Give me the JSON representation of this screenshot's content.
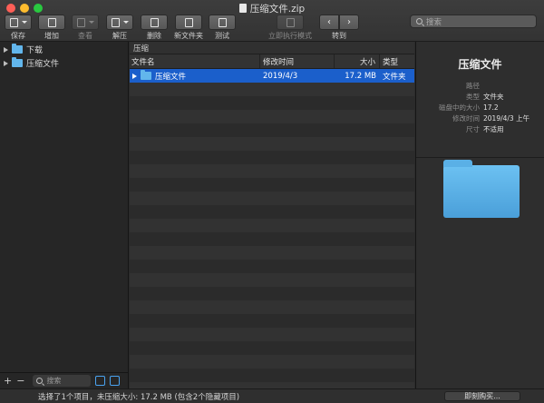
{
  "window": {
    "title": "压缩文件.zip"
  },
  "toolbar": {
    "save": "保存",
    "add": "增加",
    "view": "查看",
    "extract": "解压",
    "delete": "删除",
    "new_folder": "新文件夹",
    "test": "测试",
    "execute_now": "立即执行模式",
    "goto": "转到",
    "search_placeholder": "搜索"
  },
  "sidebar": {
    "items": [
      {
        "label": "下载"
      },
      {
        "label": "压缩文件"
      }
    ],
    "search_placeholder": "搜索"
  },
  "main": {
    "breadcrumb": "压缩",
    "columns": {
      "name": "文件名",
      "modified": "修改时间",
      "size": "大小",
      "kind": "类型"
    },
    "rows": [
      {
        "name": "压缩文件",
        "modified": "2019/4/3",
        "size": "17.2 MB",
        "kind": "文件夹"
      }
    ]
  },
  "info": {
    "title": "压缩文件",
    "fields": [
      {
        "key": "路径",
        "value": ""
      },
      {
        "key": "类型",
        "value": "文件夹"
      },
      {
        "key": "磁盘中的大小",
        "value": "17.2"
      },
      {
        "key": "修改时间",
        "value": "2019/4/3 上午"
      },
      {
        "key": "尺寸",
        "value": "不适用"
      }
    ]
  },
  "status": {
    "text": "选择了1个项目，未压缩大小: 17.2 MB (包含2个隐藏项目)",
    "buy_button": "即刻购买..."
  },
  "colors": {
    "selection": "#1b5fcb",
    "folder": "#62b6ec"
  }
}
